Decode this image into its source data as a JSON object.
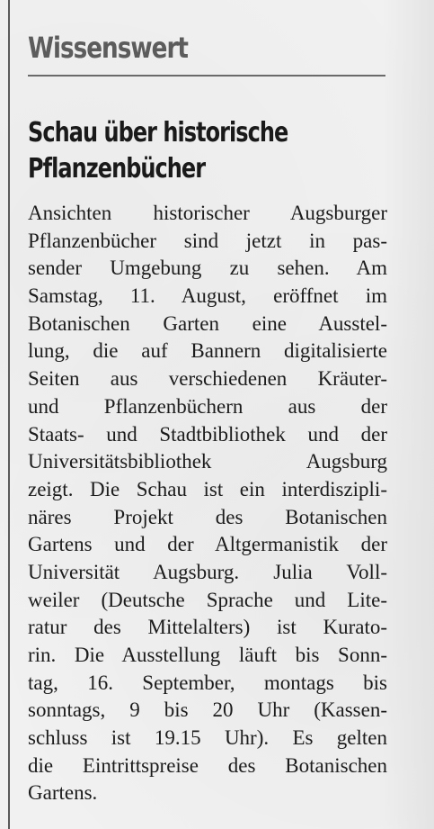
{
  "section_label": "Wissenswert",
  "headline": {
    "lines": [
      "Schau über historische",
      "Pflanzenbücher"
    ]
  },
  "body_lines": [
    "Ansichten historischer Augsburger",
    "Pflanzenbücher sind jetzt in pas-",
    "sender Umgebung zu sehen. Am",
    "Samstag, 11. August, eröffnet im",
    "Botanischen Garten eine Ausstel-",
    "lung, die auf Bannern digitalisierte",
    "Seiten aus verschiedenen Kräuter-",
    "und Pflanzenbüchern aus der",
    "Staats- und Stadtbibliothek und der",
    "Universitätsbibliothek Augsburg",
    "zeigt. Die Schau ist ein interdiszipli-",
    "näres Projekt des Botanischen",
    "Gartens und der Altgermanistik der",
    "Universität Augsburg. Julia Voll-",
    "weiler (Deutsche Sprache und Lite-",
    "ratur des Mittelalters) ist Kurato-",
    "rin. Die Ausstellung läuft bis Sonn-",
    "tag, 16. September, montags bis",
    "sonntags, 9 bis 20 Uhr (Kassen-",
    "schluss ist 19.15 Uhr). Es gelten",
    "die Eintrittspreise des Botanischen",
    "Gartens."
  ]
}
